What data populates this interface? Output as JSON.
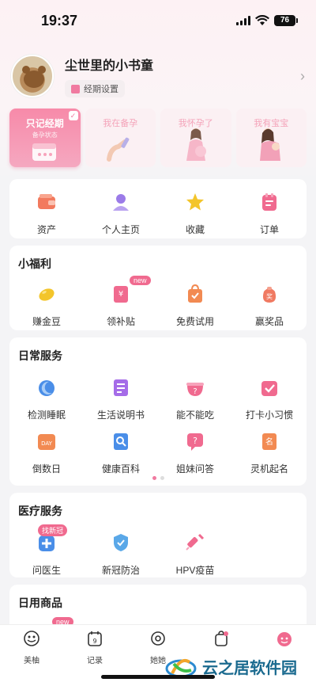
{
  "status": {
    "time": "19:37",
    "battery": "76"
  },
  "profile": {
    "username": "尘世里的小书童",
    "period_settings": "经期设置"
  },
  "modes": [
    {
      "title": "只记经期",
      "subtitle": "备孕状态",
      "active": true
    },
    {
      "title": "我在备孕",
      "active": false
    },
    {
      "title": "我怀孕了",
      "active": false
    },
    {
      "title": "我有宝宝",
      "active": false
    }
  ],
  "quick": [
    {
      "label": "资产",
      "icon": "wallet-icon",
      "color": "#f27a5e"
    },
    {
      "label": "个人主页",
      "icon": "user-icon",
      "color": "#9b7be8"
    },
    {
      "label": "收藏",
      "icon": "star-icon",
      "color": "#f3c52b"
    },
    {
      "label": "订单",
      "icon": "order-icon",
      "color": "#f06a8f"
    }
  ],
  "welfare": {
    "title": "小福利",
    "items": [
      {
        "label": "赚金豆",
        "icon": "gold-bean-icon",
        "color": "#f3c52b"
      },
      {
        "label": "领补贴",
        "icon": "subsidy-icon",
        "color": "#f06a8f",
        "tag": "new"
      },
      {
        "label": "免费试用",
        "icon": "trial-bag-icon",
        "color": "#f28a52"
      },
      {
        "label": "赢奖品",
        "icon": "prize-bag-icon",
        "color": "#f07a62"
      }
    ]
  },
  "daily": {
    "title": "日常服务",
    "items": [
      {
        "label": "检测睡眠",
        "icon": "sleep-icon",
        "color": "#4a8ee8"
      },
      {
        "label": "生活说明书",
        "icon": "manual-icon",
        "color": "#a56ce8"
      },
      {
        "label": "能不能吃",
        "icon": "food-check-icon",
        "color": "#f06a8f"
      },
      {
        "label": "打卡小习惯",
        "icon": "checkin-icon",
        "color": "#f06a8f"
      },
      {
        "label": "倒数日",
        "icon": "countdown-icon",
        "color": "#f28a52",
        "text": "DAY"
      },
      {
        "label": "健康百科",
        "icon": "encyclopedia-icon",
        "color": "#4a8ee8"
      },
      {
        "label": "姐妹问答",
        "icon": "qa-icon",
        "color": "#f06a8f"
      },
      {
        "label": "灵机起名",
        "icon": "naming-icon",
        "color": "#f28a52"
      }
    ]
  },
  "medical": {
    "title": "医疗服务",
    "items": [
      {
        "label": "问医生",
        "icon": "doctor-icon",
        "color": "#4a8ee8",
        "tag": "找新冠"
      },
      {
        "label": "新冠防治",
        "icon": "shield-icon",
        "color": "#5aa8e8"
      },
      {
        "label": "HPV疫苗",
        "icon": "vaccine-icon",
        "color": "#f06a8f"
      }
    ]
  },
  "goods": {
    "title": "日用商品",
    "tag": "new"
  },
  "tabs": [
    {
      "label": "美柚",
      "icon": "meiyou-icon"
    },
    {
      "label": "记录",
      "icon": "calendar-icon",
      "num": "9"
    },
    {
      "label": "她她",
      "icon": "community-icon"
    },
    {
      "label": "",
      "icon": "shop-bag-icon"
    },
    {
      "label": "",
      "icon": "me-icon"
    }
  ],
  "watermark": "云之居软件园"
}
